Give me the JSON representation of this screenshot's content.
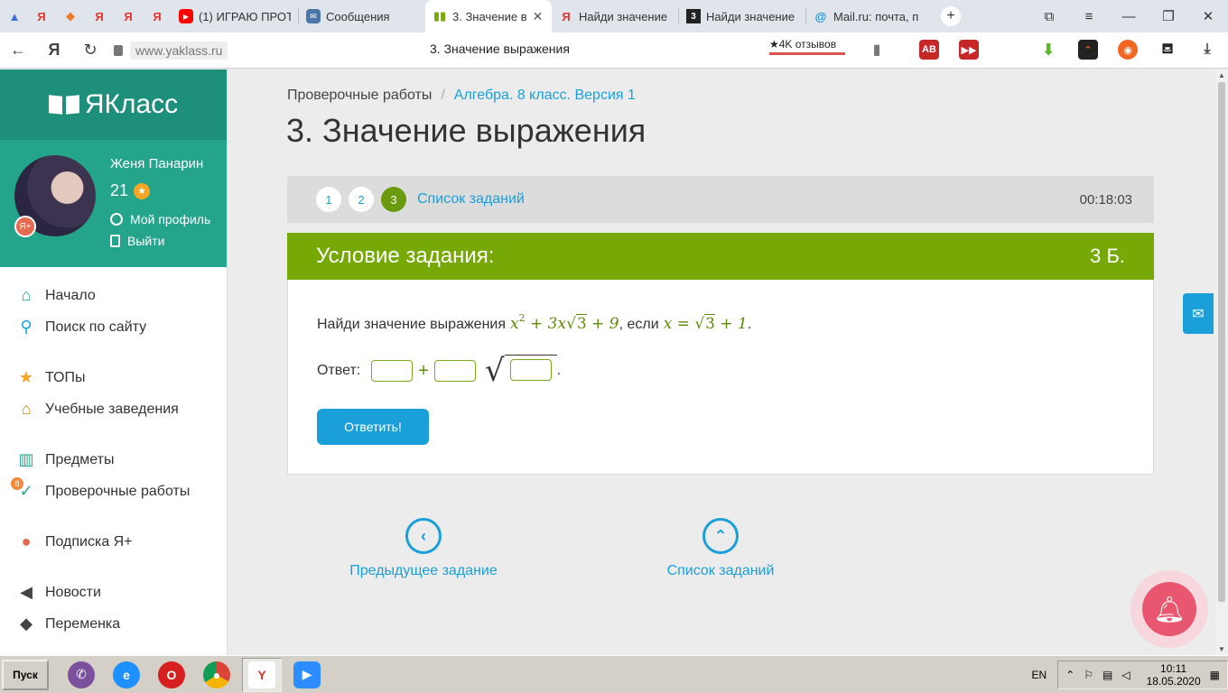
{
  "browser": {
    "tabs": [
      {
        "title": "",
        "icon": "triangle-icon",
        "color": "#3b6fd6"
      },
      {
        "title": "",
        "icon": "yandex-icon",
        "color": "#e3342f"
      },
      {
        "title": "",
        "icon": "fox-icon",
        "color": "#e97b2c"
      },
      {
        "title": "",
        "icon": "yandex-icon",
        "color": "#e3342f"
      },
      {
        "title": "",
        "icon": "yandex-icon",
        "color": "#e3342f"
      },
      {
        "title": "",
        "icon": "yandex-icon",
        "color": "#e3342f"
      },
      {
        "title": "(1) ИГРАЮ ПРОТ",
        "icon": "youtube-icon",
        "color": "#ff0000"
      },
      {
        "title": "Сообщения",
        "icon": "chat-icon",
        "color": "#4a76a8"
      },
      {
        "title": "3. Значение в",
        "icon": "yaklass-icon",
        "color": "#76a905"
      },
      {
        "title": "Найди значение",
        "icon": "yandex-icon",
        "color": "#e3342f"
      },
      {
        "title": "Найди значение",
        "icon": "znanija-icon",
        "color": "#222222"
      },
      {
        "title": "Mail.ru: почта, п",
        "icon": "mail-icon",
        "color": "#168de2"
      }
    ],
    "url": "www.yaklass.ru",
    "page_title": "3. Значение выражения",
    "reviews": "★4K отзывов"
  },
  "sidebar": {
    "logo": "ЯКласс",
    "user": {
      "name": "Женя Панарин",
      "points": "21",
      "profile_link": "Мой профиль",
      "logout_link": "Выйти"
    },
    "menu": [
      {
        "label": "Начало",
        "icon": "home-icon",
        "color": "#23a48b"
      },
      {
        "label": "Поиск по сайту",
        "icon": "search-icon",
        "color": "#1a9fd8"
      },
      {
        "label": "ТОПы",
        "icon": "star-icon",
        "color": "#f5a623"
      },
      {
        "label": "Учебные заведения",
        "icon": "institution-icon",
        "color": "#d08a1a"
      },
      {
        "label": "Предметы",
        "icon": "book-icon",
        "color": "#23a48b"
      },
      {
        "label": "Проверочные работы",
        "icon": "check-circle-icon",
        "color": "#23a48b",
        "badge": "8"
      },
      {
        "label": "Подписка Я+",
        "icon": "yplus-icon",
        "color": "#e56a4e"
      },
      {
        "label": "Новости",
        "icon": "megaphone-icon",
        "color": "#444444"
      },
      {
        "label": "Переменка",
        "icon": "bell-icon",
        "color": "#444444"
      }
    ]
  },
  "main": {
    "breadcrumb": {
      "root": "Проверочные работы",
      "current": "Алгебра. 8 класс. Версия 1"
    },
    "title": "3. Значение выражения",
    "task_numbers": [
      "1",
      "2",
      "3"
    ],
    "current_task": "3",
    "task_list_link": "Список заданий",
    "timer": "00:18:03",
    "condition_title": "Условие задания:",
    "points": "3 Б.",
    "question_prefix": "Найди значение выражения",
    "question_middle": ", если",
    "answer_label": "Ответ:",
    "submit_label": "Ответить!",
    "prev_link": "Предыдущее задание",
    "list_link": "Список заданий"
  },
  "taskbar": {
    "start": "Пуск",
    "lang": "EN",
    "time": "10:11",
    "date": "18.05.2020"
  },
  "colors": {
    "brand_teal": "#1e8f7a",
    "accent_green": "#76a905",
    "link_blue": "#1a9fd8"
  }
}
